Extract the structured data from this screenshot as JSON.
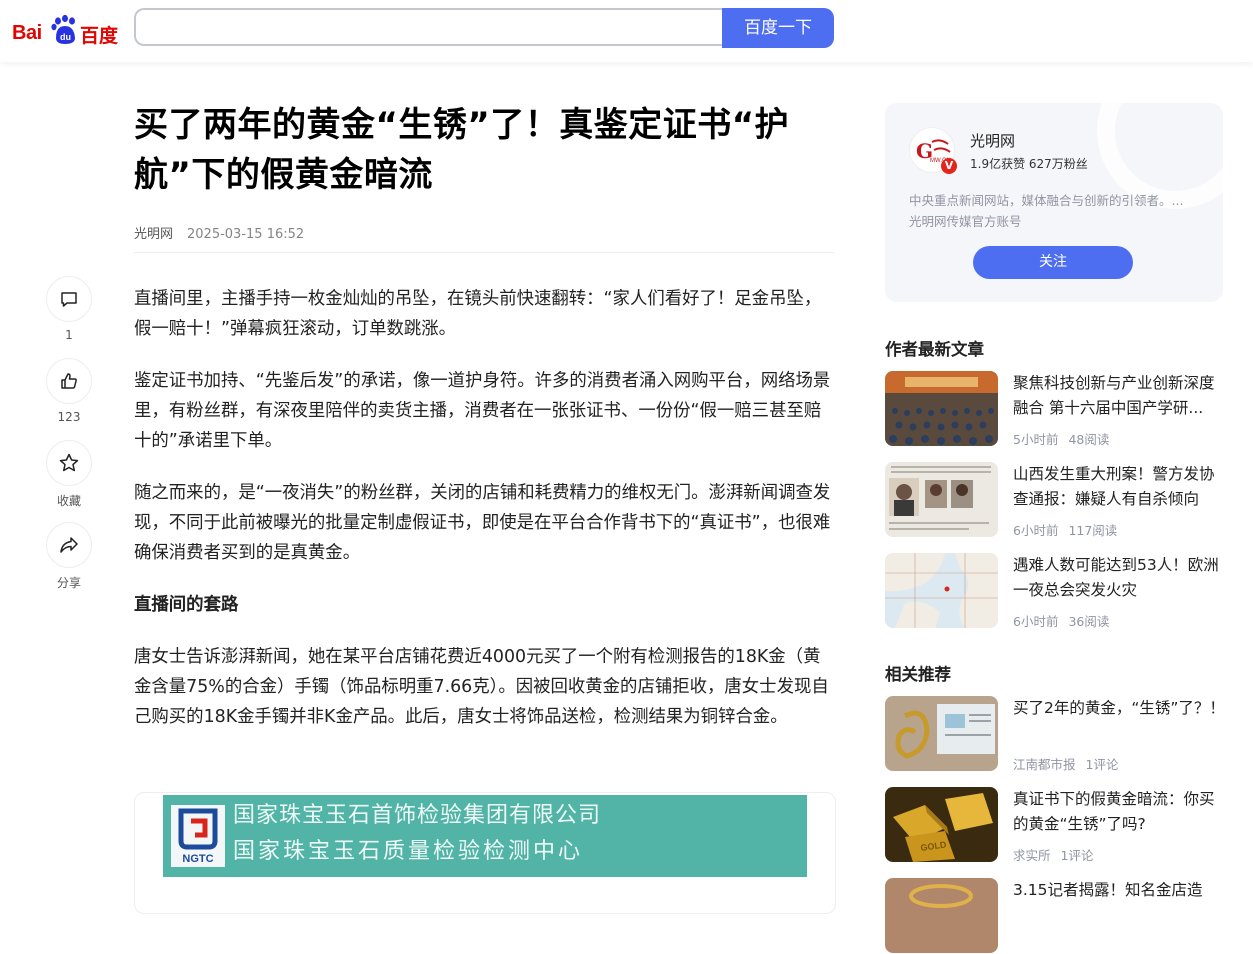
{
  "header": {
    "logo_text_bai": "Bai",
    "logo_text_du": "du",
    "logo_text_cn": "百度",
    "search_value": "",
    "search_button": "百度一下"
  },
  "rail": [
    {
      "icon": "comment-icon",
      "label": "1"
    },
    {
      "icon": "like-icon",
      "label": "123"
    },
    {
      "icon": "star-icon",
      "label": "收藏"
    },
    {
      "icon": "share-icon",
      "label": "分享"
    }
  ],
  "article": {
    "title": "买了两年的黄金“生锈”了！真鉴定证书“护航”下的假黄金暗流",
    "source": "光明网",
    "date": "2025-03-15 16:52",
    "paragraphs": [
      "直播间里，主播手持一枚金灿灿的吊坠，在镜头前快速翻转：“家人们看好了！足金吊坠，假一赔十！”弹幕疯狂滚动，订单数跳涨。",
      "鉴定证书加持、“先鉴后发”的承诺，像一道护身符。许多的消费者涌入网购平台，网络场景里，有粉丝群，有深夜里陪伴的卖货主播，消费者在一张张证书、一份份“假一赔三甚至赔十的”承诺里下单。",
      "随之而来的，是“一夜消失”的粉丝群，关闭的店铺和耗费精力的维权无门。澎湃新闻调查发现，不同于此前被曝光的批量定制虚假证书，即使是在平台合作背书下的“真证书”，也很难确保消费者买到的是真黄金。"
    ],
    "subheading": "直播间的套路",
    "paragraph_after": "唐女士告诉澎湃新闻，她在某平台店铺花费近4000元买了一个附有检测报告的18K金（黄金含量75%的合金）手镯（饰品标明重7.66克）。因被回收黄金的店铺拒收，唐女士发现自己购买的18K金手镯并非K金产品。此后，唐女士将饰品送检，检测结果为铜锌合金。",
    "figure": {
      "line1": "国家珠宝玉石首饰检验集团有限公司",
      "line2": "国家珠宝玉石质量检验检测中心",
      "logo_text": "NGTC"
    }
  },
  "author": {
    "name": "光明网",
    "stats": "1.9亿获赞 627万粉丝",
    "desc_line1": "中央重点新闻网站，媒体融合与创新的引领者。...",
    "desc_line2": "光明网传媒官方账号",
    "follow": "关注",
    "verified_mark": "V"
  },
  "latest_title": "作者最新文章",
  "latest": [
    {
      "title": "聚焦科技创新与产业创新深度融合 第十六届中国产学研...",
      "time": "5小时前",
      "reads": "48阅读"
    },
    {
      "title": "山西发生重大刑案！警方发协查通报：嫌疑人有自杀倾向",
      "time": "6小时前",
      "reads": "117阅读"
    },
    {
      "title": "遇难人数可能达到53人！欧洲一夜总会突发火灾",
      "time": "6小时前",
      "reads": "36阅读"
    }
  ],
  "related_title": "相关推荐",
  "related": [
    {
      "title": "买了2年的黄金，“生锈”了？！",
      "source": "江南都市报",
      "comments": "1评论"
    },
    {
      "title": "真证书下的假黄金暗流：你买的黄金“生锈”了吗?",
      "source": "求实所",
      "comments": "1评论"
    },
    {
      "title": "3.15记者揭露！知名金店造",
      "source": "",
      "comments": ""
    }
  ],
  "colors": {
    "brand_blue": "#4e6ef2",
    "baidu_red": "#e10602",
    "cert_green": "#52b4a6"
  }
}
